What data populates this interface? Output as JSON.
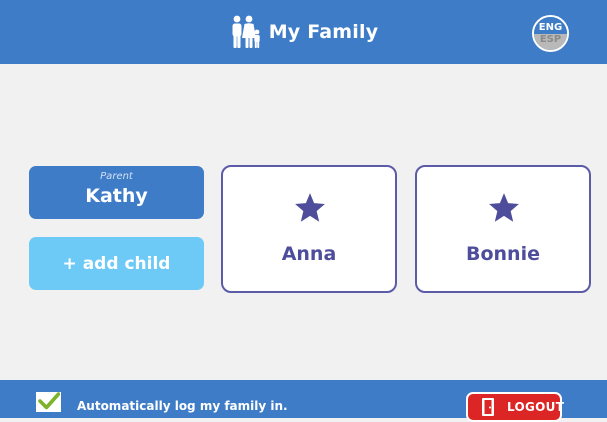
{
  "header": {
    "title": "My Family",
    "icon": "family-icon",
    "language": {
      "current": "ENG",
      "alternate": "ESP"
    }
  },
  "parent": {
    "role_label": "Parent",
    "name": "Kathy"
  },
  "add_child": {
    "label": "+ add child"
  },
  "children": [
    {
      "name": "Anna",
      "icon": "star-icon"
    },
    {
      "name": "Bonnie",
      "icon": "star-icon"
    }
  ],
  "footer": {
    "auto_login_checked": true,
    "auto_login_label": "Automatically log my family in.",
    "logout_label": "LOGOUT",
    "logout_icon": "door-icon"
  },
  "colors": {
    "primary_blue": "#3f7cc7",
    "light_blue": "#6dcaf6",
    "card_border": "#5b5ba8",
    "star": "#4d4d9c",
    "logout_red": "#dc2626",
    "check_green": "#7db32a",
    "background": "#f1f1f1"
  }
}
